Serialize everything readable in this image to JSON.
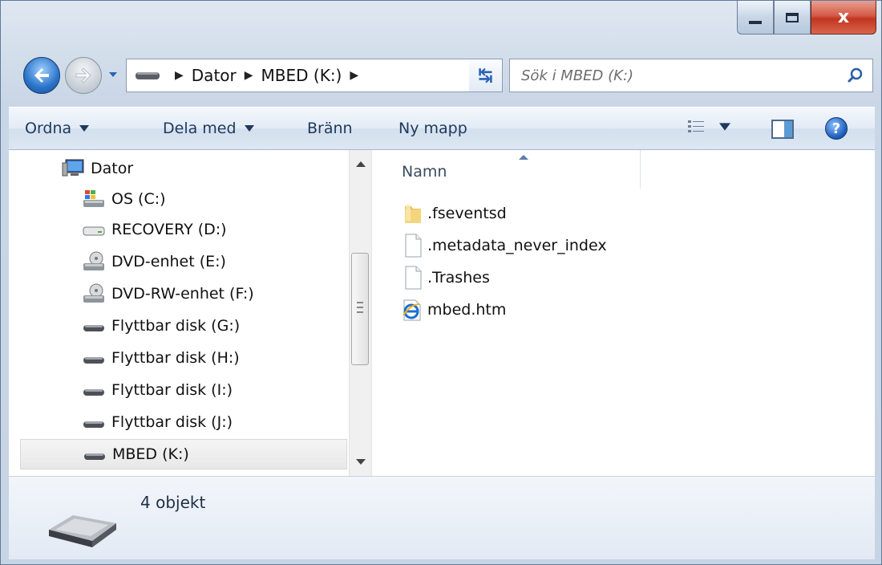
{
  "window": {
    "caption_buttons": {
      "close_label": "x"
    }
  },
  "address": {
    "crumbs": [
      "Dator",
      "MBED (K:)"
    ],
    "search_placeholder": "Sök i MBED (K:)"
  },
  "toolbar": {
    "organize": "Ordna",
    "share": "Dela med",
    "burn": "Bränn",
    "new_folder": "Ny mapp"
  },
  "navigation": {
    "items": [
      {
        "label": "Dator",
        "icon": "computer-icon"
      },
      {
        "label": "OS (C:)",
        "icon": "windows-drive-icon"
      },
      {
        "label": "RECOVERY (D:)",
        "icon": "hard-drive-icon"
      },
      {
        "label": "DVD-enhet (E:)",
        "icon": "dvd-drive-icon"
      },
      {
        "label": "DVD-RW-enhet (F:)",
        "icon": "dvd-drive-icon"
      },
      {
        "label": "Flyttbar disk (G:)",
        "icon": "removable-drive-icon"
      },
      {
        "label": "Flyttbar disk (H:)",
        "icon": "removable-drive-icon"
      },
      {
        "label": "Flyttbar disk (I:)",
        "icon": "removable-drive-icon"
      },
      {
        "label": "Flyttbar disk (J:)",
        "icon": "removable-drive-icon"
      },
      {
        "label": "MBED (K:)",
        "icon": "removable-drive-icon",
        "selected": true
      }
    ]
  },
  "files": {
    "column_name": "Namn",
    "items": [
      {
        "name": ".fseventsd",
        "icon": "folder-icon"
      },
      {
        "name": ".metadata_never_index",
        "icon": "file-icon"
      },
      {
        "name": ".Trashes",
        "icon": "file-icon"
      },
      {
        "name": "mbed.htm",
        "icon": "ie-document-icon"
      }
    ]
  },
  "details": {
    "count": "4 objekt"
  },
  "colors": {
    "accent_blue": "#2a73c9",
    "close_red": "#c2351f",
    "command_text": "#1e395b"
  }
}
